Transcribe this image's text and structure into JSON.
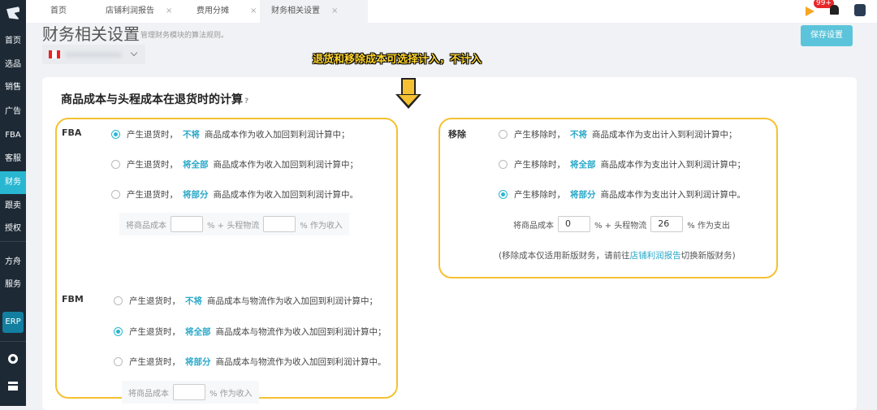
{
  "sidebar": {
    "items": [
      "首页",
      "选品",
      "销售",
      "广告",
      "FBA",
      "客服",
      "财务",
      "跟卖",
      "授权",
      "方舟",
      "服务"
    ],
    "active": "财务",
    "erp": "ERP"
  },
  "tabs": [
    {
      "label": "首页"
    },
    {
      "label": "店铺利润报告"
    },
    {
      "label": "费用分摊"
    },
    {
      "label": "财务相关设置",
      "active": true
    }
  ],
  "header": {
    "notification_badge": "99+"
  },
  "page": {
    "title": "财务相关设置",
    "subtitle": "管理财务模块的算法规则。",
    "save_label": "保存设置"
  },
  "annotation": "退货和移除成本可选择计入，不计入",
  "card": {
    "title": "商品成本与头程成本在退货时的计算",
    "fba": {
      "label": "FBA",
      "options": [
        {
          "pre": "产生退货时，",
          "hl": "不将",
          "post": "商品成本作为收入加回到利润计算中；",
          "selected": true
        },
        {
          "pre": "产生退货时，",
          "hl": "将全部",
          "post": "商品成本作为收入加回到利润计算中；",
          "selected": false
        },
        {
          "pre": "产生退货时，",
          "hl": "将部分",
          "post": "商品成本作为收入加回到利润计算中。",
          "selected": false
        }
      ],
      "partial": {
        "a": "将商品成本",
        "b": "% + 头程物流",
        "c": "% 作为收入",
        "v1": "",
        "v2": ""
      }
    },
    "fbm": {
      "label": "FBM",
      "options": [
        {
          "pre": "产生退货时，",
          "hl": "不将",
          "post": "商品成本与物流作为收入加回到利润计算中；",
          "selected": false
        },
        {
          "pre": "产生退货时，",
          "hl": "将全部",
          "post": "商品成本与物流作为收入加回到利润计算中；",
          "selected": true
        },
        {
          "pre": "产生退货时，",
          "hl": "将部分",
          "post": "商品成本与物流作为收入加回到利润计算中。",
          "selected": false
        }
      ],
      "partial": {
        "a": "将商品成本",
        "c": "% 作为收入",
        "v1": ""
      }
    },
    "removal": {
      "label": "移除",
      "options": [
        {
          "pre": "产生移除时，",
          "hl": "不将",
          "post": "商品成本作为支出计入到利润计算中；",
          "selected": false
        },
        {
          "pre": "产生移除时，",
          "hl": "将全部",
          "post": "商品成本作为支出计入到利润计算中；",
          "selected": false
        },
        {
          "pre": "产生移除时，",
          "hl": "将部分",
          "post": "商品成本作为支出计入到利润计算中。",
          "selected": true
        }
      ],
      "partial": {
        "a": "将商品成本",
        "b": "% + 头程物流",
        "c": "% 作为支出",
        "v1": "0",
        "v2": "26"
      },
      "note_pre": "(移除成本仅适用新版财务，请前往",
      "note_link": "店铺利润报告",
      "note_post": "切换新版财务)"
    }
  },
  "colors": {
    "accent": "#29b6d1",
    "highlight_box": "#f5c132",
    "sidebar": "#1d2a36"
  }
}
